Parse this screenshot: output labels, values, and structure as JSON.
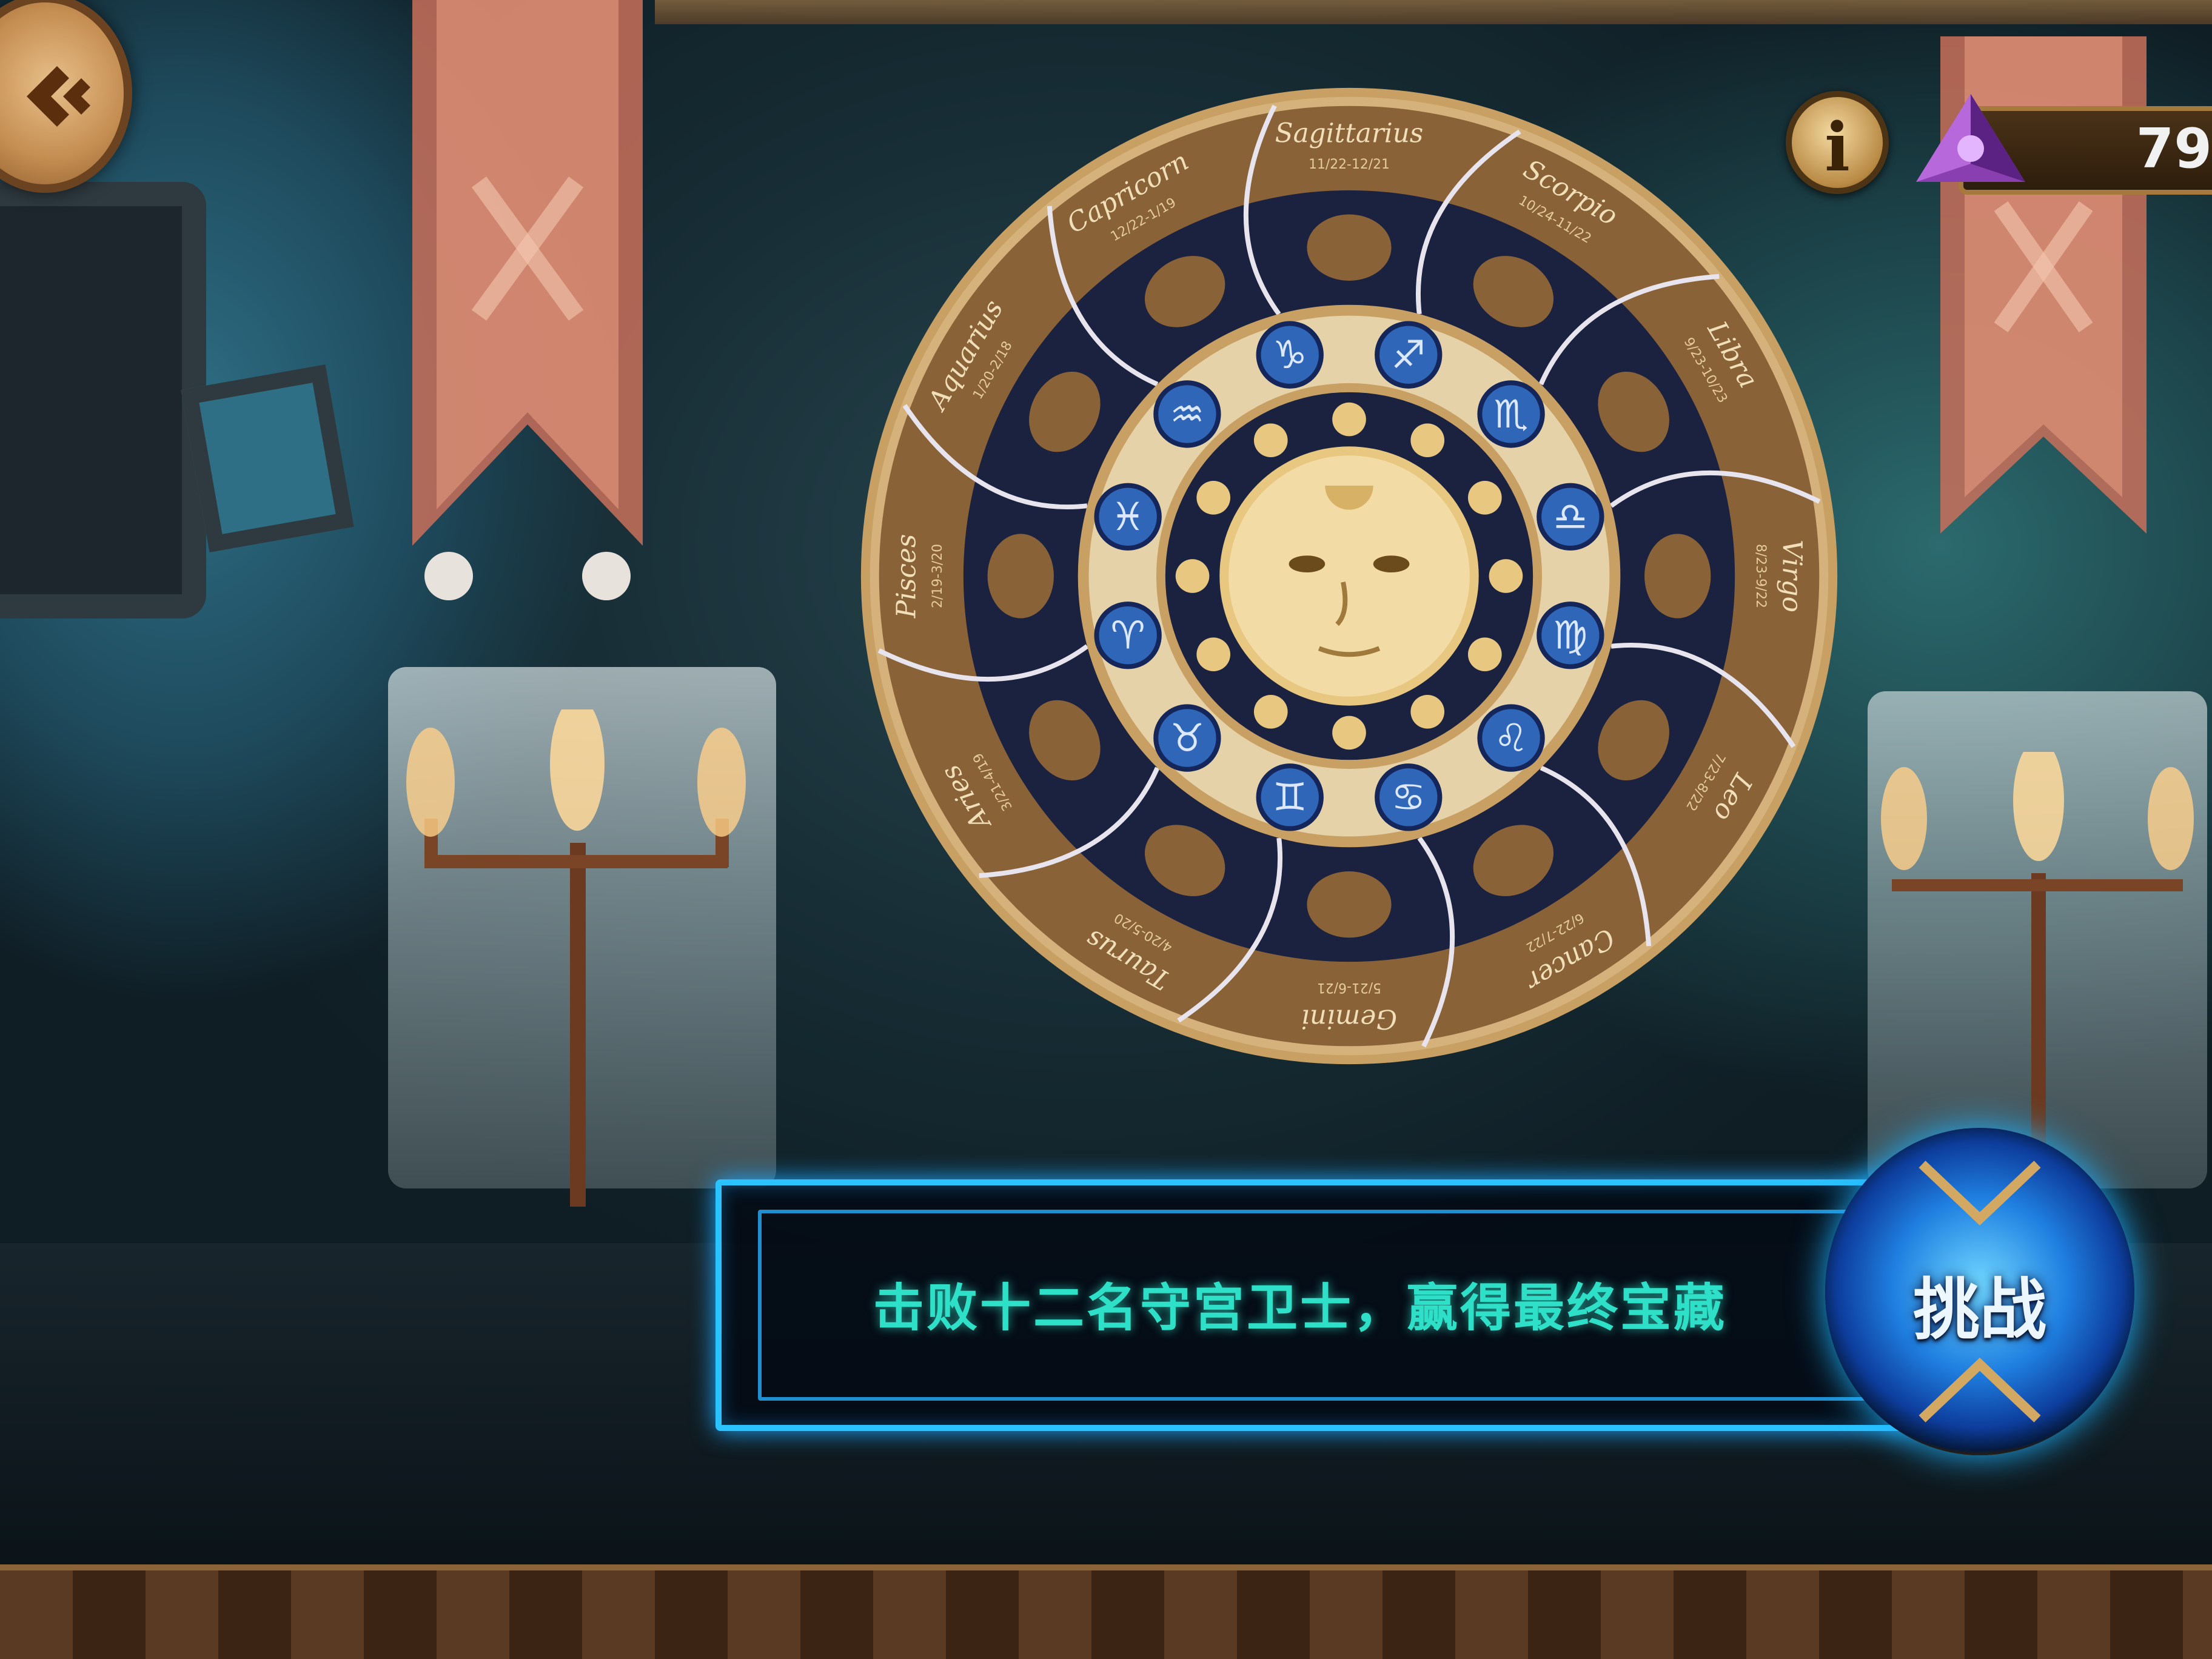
{
  "hud": {
    "back_button_icon": "back-arrow-icon",
    "info_icon_glyph": "i",
    "gem_icon": "purple-pyramid-gem-icon",
    "gem_count": "79"
  },
  "zodiac_wheel": {
    "signs": [
      {
        "name": "Sagittarius",
        "dates": "11/22-12/21"
      },
      {
        "name": "Scorpio",
        "dates": "10/24-11/22"
      },
      {
        "name": "Libra",
        "dates": "9/23-10/23"
      },
      {
        "name": "Virgo",
        "dates": "8/23-9/22"
      },
      {
        "name": "Leo",
        "dates": "7/23-8/22"
      },
      {
        "name": "Cancer",
        "dates": "6/22-7/22"
      },
      {
        "name": "Gemini",
        "dates": "5/21-6/21"
      },
      {
        "name": "Taurus",
        "dates": "4/20-5/20"
      },
      {
        "name": "Aries",
        "dates": "3/21-4/19"
      },
      {
        "name": "Pisces",
        "dates": "2/19-3/20"
      },
      {
        "name": "Aquarius",
        "dates": "1/20-2/18"
      },
      {
        "name": "Capricorn",
        "dates": "12/22-1/19"
      }
    ],
    "symbols": [
      "♑",
      "♐",
      "♏",
      "♎",
      "♍",
      "♌",
      "♋",
      "♊",
      "♉",
      "♈",
      "♓",
      "♒"
    ],
    "colors": {
      "gold": "#c9a063",
      "dark": "#1a2240",
      "blue": "#2f66b8"
    }
  },
  "quest": {
    "description": "击败十二名守宫卫士，赢得最终宝藏"
  },
  "challenge_button": {
    "label": "挑战"
  }
}
